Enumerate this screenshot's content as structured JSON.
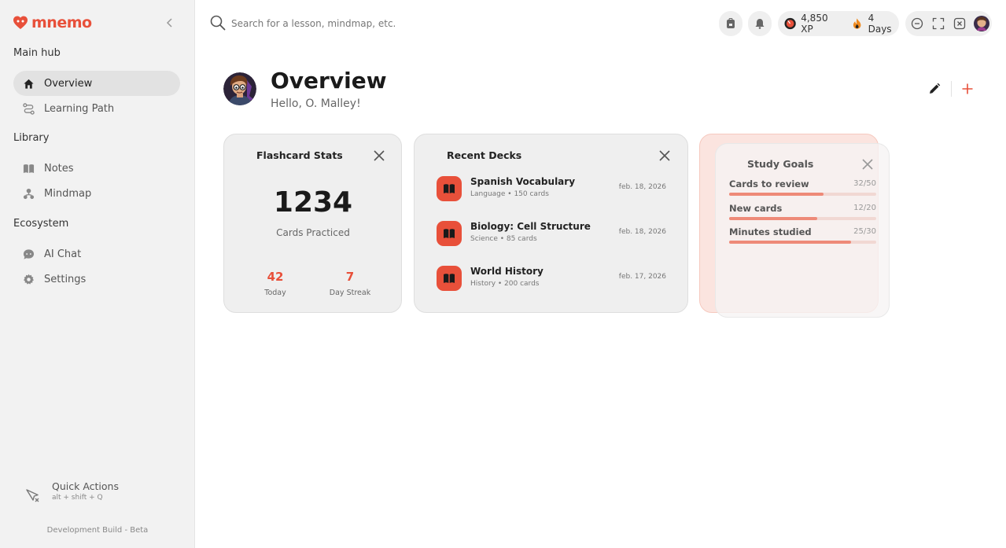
{
  "app": {
    "name": "mnemo"
  },
  "sidebar": {
    "sections": [
      {
        "title": "Main hub",
        "items": [
          {
            "label": "Overview",
            "icon": "home-icon",
            "active": true
          },
          {
            "label": "Learning Path",
            "icon": "path-icon",
            "active": false
          }
        ]
      },
      {
        "title": "Library",
        "items": [
          {
            "label": "Notes",
            "icon": "book-icon",
            "active": false
          },
          {
            "label": "Mindmap",
            "icon": "mindmap-icon",
            "active": false
          }
        ]
      },
      {
        "title": "Ecosystem",
        "items": [
          {
            "label": "AI Chat",
            "icon": "chat-icon",
            "active": false
          },
          {
            "label": "Settings",
            "icon": "gear-icon",
            "active": false
          }
        ]
      }
    ],
    "quick_actions": {
      "title": "Quick Actions",
      "shortcut": "alt + shift + Q"
    },
    "build_label": "Development Build - Beta"
  },
  "topbar": {
    "search_placeholder": "Search for a lesson, mindmap, etc.",
    "xp": "4,850 XP",
    "streak": "4 Days"
  },
  "header": {
    "title": "Overview",
    "greeting": "Hello, O. Malley!"
  },
  "flashcard_stats": {
    "title": "Flashcard Stats",
    "cards_practiced": "1234",
    "cards_practiced_label": "Cards Practiced",
    "today_value": "42",
    "today_label": "Today",
    "streak_value": "7",
    "streak_label": "Day Streak"
  },
  "recent_decks": {
    "title": "Recent Decks",
    "decks": [
      {
        "name": "Spanish Vocabulary",
        "meta": "Language • 150 cards",
        "date": "feb. 18, 2026"
      },
      {
        "name": "Biology: Cell Structure",
        "meta": "Science • 85 cards",
        "date": "feb. 18, 2026"
      },
      {
        "name": "World History",
        "meta": "History • 200 cards",
        "date": "feb. 17, 2026"
      }
    ]
  },
  "study_goals": {
    "title": "Study Goals",
    "goals": [
      {
        "label": "Cards to review",
        "count": "32/50",
        "progress": 0.64
      },
      {
        "label": "New cards",
        "count": "12/20",
        "progress": 0.6
      },
      {
        "label": "Minutes studied",
        "count": "25/30",
        "progress": 0.83
      }
    ]
  },
  "colors": {
    "accent": "#e8503a",
    "sidebar_bg": "#f2f2f2",
    "card_bg": "#efefef"
  }
}
